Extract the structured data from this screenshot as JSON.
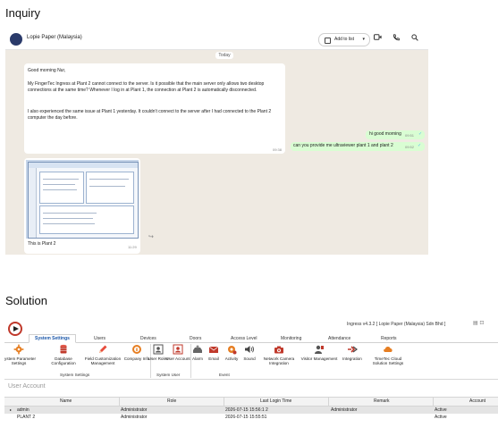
{
  "inquiry_heading": "Inquiry",
  "solution_heading": "Solution",
  "chat": {
    "contact_name": "Lopie Paper (Malaysia)",
    "add_to_list_label": "Add to list",
    "date_divider": "Today",
    "incoming_message": {
      "greeting": "Good morning Nur,",
      "paragraph1": "My FingerTec Ingress at Plant 2 cannot connect to the server. Is it possible that the main server only allows two desktop connections at the same time? Whenever I log in at Plant 1, the connection at Plant 2 is automatically disconnected.",
      "paragraph2": "I also experienced the same issue at Plant 1 yesterday. It couldn't connect to the server after I had connected to the Plant 2 computer the day before.",
      "time": "09:38"
    },
    "outgoing_messages": [
      {
        "text": "hi good morning",
        "time": "09:51"
      },
      {
        "text": "can you provide me ultraviewer plant 1 and plant 2",
        "time": "09:52"
      }
    ],
    "image_message": {
      "caption": "This is Plant 2",
      "time": "11:29"
    },
    "icons": {
      "avatar": "avatar-icon",
      "add_list": "list-icon",
      "video": "video-call-icon",
      "phone": "phone-icon",
      "search": "search-icon",
      "forward": "forward-icon",
      "tick": "double-check-icon"
    }
  },
  "app": {
    "title": "Ingress v4.3.2 [ Lopie Paper (Malaysia) Sdn Bhd ]",
    "tabs": [
      "System Settings",
      "Users",
      "Devices",
      "Doors",
      "Access Level",
      "Monitoring",
      "Attendance",
      "Reports"
    ],
    "active_tab": "System Settings",
    "ribbon_tools": [
      {
        "label": "System Parameter Settings",
        "icon": "gear-icon",
        "color": "#e67e22"
      },
      {
        "label": "Database Configuration",
        "icon": "database-icon",
        "color": "#c0392b"
      },
      {
        "label": "Field Customization Management",
        "icon": "pencil-icon",
        "color": "#e74c3c"
      },
      {
        "label": "Company Info",
        "icon": "info-icon",
        "color": "#e67e22"
      },
      {
        "label": "User Roles",
        "icon": "user-roles-icon",
        "color": "#555555"
      },
      {
        "label": "User Account",
        "icon": "user-account-icon",
        "color": "#c0392b"
      },
      {
        "label": "Alarm",
        "icon": "alarm-icon",
        "color": "#666666"
      },
      {
        "label": "Email",
        "icon": "email-icon",
        "color": "#c0392b"
      },
      {
        "label": "Activity",
        "icon": "activity-icon",
        "color": "#e67e22"
      },
      {
        "label": "Sound",
        "icon": "sound-icon",
        "color": "#444444"
      },
      {
        "label": "Network Camera Integration",
        "icon": "camera-icon",
        "color": "#c0392b"
      },
      {
        "label": "Visitor Management",
        "icon": "visitor-icon",
        "color": "#c0392b"
      },
      {
        "label": "Integration",
        "icon": "integration-icon",
        "color": "#c0392b"
      },
      {
        "label": "TimeTec Cloud Solution Settings",
        "icon": "cloud-icon",
        "color": "#e67e22"
      }
    ],
    "groups": [
      "System Settings",
      "System User",
      "Event"
    ],
    "section_title": "User Account",
    "table": {
      "columns": [
        "Name",
        "Role",
        "Last Login Time",
        "Remark",
        "Account"
      ],
      "rows": [
        {
          "name": "admin",
          "role": "Administrator",
          "last_login": "2026-07-15 15:56:1 2",
          "remark": "Administrator",
          "account": "Active"
        },
        {
          "name": "PLANT 2",
          "role": "Administrator",
          "last_login": "2026-07-15 15:55:51",
          "remark": "",
          "account": "Active"
        }
      ]
    }
  }
}
